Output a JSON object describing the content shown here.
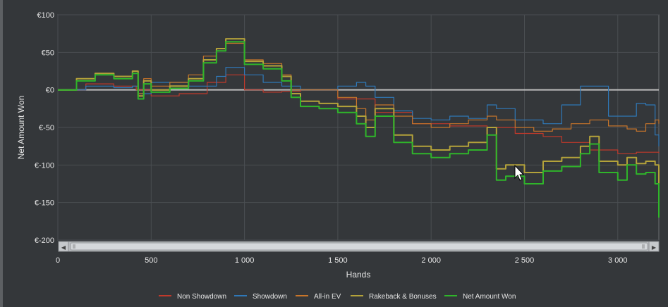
{
  "chart_data": {
    "type": "line",
    "xlabel": "Hands",
    "ylabel": "Net Amount Won",
    "xlim": [
      0,
      3220
    ],
    "ylim": [
      -200,
      100
    ],
    "x_ticks": [
      {
        "value": 0,
        "label": "0"
      },
      {
        "value": 500,
        "label": "500"
      },
      {
        "value": 1000,
        "label": "1 000"
      },
      {
        "value": 1500,
        "label": "1 500"
      },
      {
        "value": 2000,
        "label": "2 000"
      },
      {
        "value": 2500,
        "label": "2 500"
      },
      {
        "value": 3000,
        "label": "3 000"
      }
    ],
    "y_ticks": [
      {
        "value": 100,
        "label": "€100"
      },
      {
        "value": 50,
        "label": "€50"
      },
      {
        "value": 0,
        "label": "€0"
      },
      {
        "value": -50,
        "label": "€-50"
      },
      {
        "value": -100,
        "label": "€-100"
      },
      {
        "value": -150,
        "label": "€-150"
      },
      {
        "value": -200,
        "label": "€-200"
      }
    ],
    "grid": true,
    "legend_position": "bottom",
    "series": [
      {
        "name": "Non Showdown",
        "color": "#c0392b",
        "x": [
          0,
          150,
          300,
          420,
          500,
          650,
          800,
          900,
          1000,
          1100,
          1200,
          1300,
          1500,
          1700,
          1900,
          2100,
          2300,
          2450,
          2600,
          2700,
          2850,
          3000,
          3100,
          3220
        ],
        "y": [
          0,
          8,
          5,
          0,
          -8,
          -5,
          10,
          20,
          0,
          -3,
          -2,
          0,
          -12,
          -30,
          -45,
          -48,
          -50,
          -58,
          -62,
          -70,
          -80,
          -85,
          -83,
          -84
        ]
      },
      {
        "name": "Showdown",
        "color": "#2f78b8",
        "x": [
          0,
          150,
          300,
          400,
          430,
          500,
          700,
          850,
          900,
          1000,
          1100,
          1200,
          1300,
          1500,
          1600,
          1650,
          1700,
          1800,
          1900,
          2000,
          2100,
          2200,
          2300,
          2350,
          2450,
          2600,
          2700,
          2800,
          2850,
          2950,
          3000,
          3100,
          3150,
          3200,
          3220
        ],
        "y": [
          0,
          5,
          3,
          5,
          -5,
          10,
          5,
          18,
          30,
          20,
          10,
          5,
          0,
          5,
          10,
          5,
          -10,
          -28,
          -38,
          -40,
          -35,
          -38,
          -20,
          -25,
          -40,
          -45,
          -20,
          5,
          5,
          -35,
          -35,
          -18,
          -20,
          -60,
          -75
        ]
      },
      {
        "name": "All-in EV",
        "color": "#c8752a",
        "x": [
          0,
          100,
          200,
          300,
          400,
          430,
          460,
          500,
          600,
          700,
          780,
          850,
          900,
          1000,
          1100,
          1200,
          1250,
          1300,
          1500,
          1600,
          1650,
          1700,
          1800,
          1900,
          2000,
          2100,
          2200,
          2300,
          2350,
          2450,
          2550,
          2650,
          2750,
          2850,
          2950,
          3050,
          3100,
          3150,
          3200,
          3220
        ],
        "y": [
          0,
          15,
          22,
          18,
          25,
          -5,
          15,
          5,
          10,
          20,
          45,
          55,
          62,
          40,
          35,
          20,
          0,
          0,
          -10,
          -25,
          -40,
          -20,
          -35,
          -45,
          -50,
          -45,
          -40,
          -35,
          -40,
          -50,
          -55,
          -52,
          -45,
          -40,
          -48,
          -52,
          -55,
          -45,
          -40,
          -45
        ]
      },
      {
        "name": "Rakeback & Bonuses",
        "color": "#b3a23a",
        "x": [
          0,
          100,
          200,
          300,
          400,
          430,
          460,
          500,
          600,
          700,
          780,
          850,
          900,
          1000,
          1100,
          1200,
          1250,
          1300,
          1400,
          1500,
          1600,
          1650,
          1700,
          1800,
          1900,
          2000,
          2100,
          2200,
          2300,
          2350,
          2400,
          2500,
          2600,
          2700,
          2800,
          2850,
          2900,
          3000,
          3050,
          3100,
          3150,
          3200,
          3220
        ],
        "y": [
          0,
          15,
          22,
          18,
          25,
          -8,
          12,
          0,
          5,
          15,
          40,
          55,
          68,
          38,
          32,
          18,
          -5,
          -15,
          -18,
          -22,
          -35,
          -50,
          -25,
          -60,
          -75,
          -80,
          -75,
          -70,
          -50,
          -105,
          -100,
          -110,
          -95,
          -90,
          -75,
          -62,
          -95,
          -100,
          -90,
          -98,
          -95,
          -100,
          -165
        ]
      },
      {
        "name": "Net Amount Won",
        "color": "#2fb52a",
        "x": [
          0,
          100,
          200,
          300,
          400,
          430,
          460,
          500,
          600,
          700,
          780,
          850,
          900,
          1000,
          1100,
          1200,
          1250,
          1300,
          1400,
          1500,
          1600,
          1650,
          1700,
          1800,
          1900,
          2000,
          2100,
          2200,
          2300,
          2350,
          2400,
          2500,
          2600,
          2700,
          2800,
          2850,
          2900,
          3000,
          3050,
          3100,
          3150,
          3200,
          3220
        ],
        "y": [
          0,
          12,
          20,
          15,
          22,
          -12,
          8,
          -3,
          2,
          12,
          36,
          52,
          64,
          34,
          28,
          12,
          -10,
          -22,
          -25,
          -30,
          -45,
          -62,
          -35,
          -70,
          -85,
          -90,
          -85,
          -80,
          -60,
          -120,
          -115,
          -125,
          -108,
          -102,
          -85,
          -72,
          -110,
          -120,
          -100,
          -112,
          -110,
          -125,
          -170
        ]
      }
    ]
  },
  "scrollbar": {
    "left_arrow": "◀",
    "right_arrow": "▶"
  },
  "cursor": "mouse-pointer-icon"
}
